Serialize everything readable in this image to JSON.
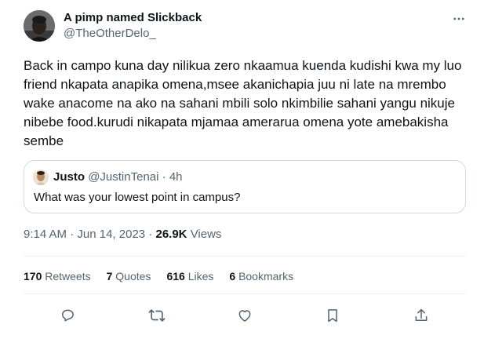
{
  "author": {
    "name": "A pimp named Slickback",
    "handle": "@TheOtherDelo_"
  },
  "tweet": {
    "text": "Back in campo kuna day nilikua zero nkaamua kuenda kudishi kwa my luo friend nkapata anapika omena,msee akanichapia juu ni late na mrembo wake anacome na ako na sahani mbili solo nkimbilie sahani yangu nikuje nibebe food.kurudi nikapata mjamaa amerarua omena yote amebakisha sembe"
  },
  "quote": {
    "name": "Justo",
    "handle": "@JustinTenai",
    "separator": "·",
    "age": "4h",
    "text": "What was your lowest point in campus?"
  },
  "meta": {
    "time": "9:14 AM",
    "separator": "·",
    "date": "Jun 14, 2023",
    "views_count": "26.9K",
    "views_label": "Views"
  },
  "stats": {
    "retweets_count": "170",
    "retweets_label": "Retweets",
    "quotes_count": "7",
    "quotes_label": "Quotes",
    "likes_count": "616",
    "likes_label": "Likes",
    "bookmarks_count": "6",
    "bookmarks_label": "Bookmarks"
  },
  "icons": {
    "more": "more-icon",
    "reply": "reply-icon",
    "retweet": "retweet-icon",
    "like": "heart-icon",
    "bookmark": "bookmark-icon",
    "share": "share-icon"
  },
  "colors": {
    "text": "#0f1419",
    "secondary": "#536471",
    "border": "#cfd9de",
    "divider": "#eff3f4"
  }
}
